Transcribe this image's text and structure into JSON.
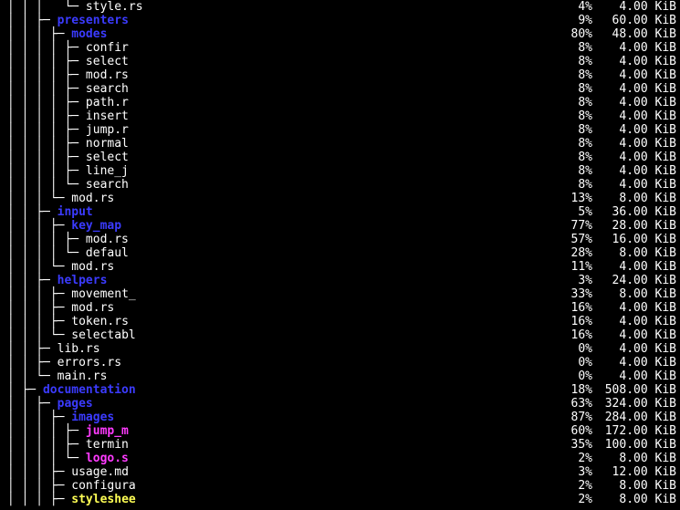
{
  "rows": [
    {
      "prefix": " │ │ │   └─ ",
      "name": "style.rs",
      "cls": "c-white",
      "pct": "4%",
      "size": "4.00 KiB"
    },
    {
      "prefix": " │ │ ├─ ",
      "name": "presenters",
      "cls": "c-blue",
      "pct": "9%",
      "size": "60.00 KiB"
    },
    {
      "prefix": " │ │ │ ├─ ",
      "name": "modes",
      "cls": "c-blue",
      "pct": "80%",
      "size": "48.00 KiB"
    },
    {
      "prefix": " │ │ │ │ ├─ ",
      "name": "confir",
      "cls": "c-white",
      "pct": "8%",
      "size": "4.00 KiB"
    },
    {
      "prefix": " │ │ │ │ ├─ ",
      "name": "select",
      "cls": "c-white",
      "pct": "8%",
      "size": "4.00 KiB"
    },
    {
      "prefix": " │ │ │ │ ├─ ",
      "name": "mod.rs",
      "cls": "c-white",
      "pct": "8%",
      "size": "4.00 KiB"
    },
    {
      "prefix": " │ │ │ │ ├─ ",
      "name": "search",
      "cls": "c-white",
      "pct": "8%",
      "size": "4.00 KiB"
    },
    {
      "prefix": " │ │ │ │ ├─ ",
      "name": "path.r",
      "cls": "c-white",
      "pct": "8%",
      "size": "4.00 KiB"
    },
    {
      "prefix": " │ │ │ │ ├─ ",
      "name": "insert",
      "cls": "c-white",
      "pct": "8%",
      "size": "4.00 KiB"
    },
    {
      "prefix": " │ │ │ │ ├─ ",
      "name": "jump.r",
      "cls": "c-white",
      "pct": "8%",
      "size": "4.00 KiB"
    },
    {
      "prefix": " │ │ │ │ ├─ ",
      "name": "normal",
      "cls": "c-white",
      "pct": "8%",
      "size": "4.00 KiB"
    },
    {
      "prefix": " │ │ │ │ ├─ ",
      "name": "select",
      "cls": "c-white",
      "pct": "8%",
      "size": "4.00 KiB"
    },
    {
      "prefix": " │ │ │ │ ├─ ",
      "name": "line_j",
      "cls": "c-white",
      "pct": "8%",
      "size": "4.00 KiB"
    },
    {
      "prefix": " │ │ │ │ └─ ",
      "name": "search",
      "cls": "c-white",
      "pct": "8%",
      "size": "4.00 KiB"
    },
    {
      "prefix": " │ │ │ └─ ",
      "name": "mod.rs",
      "cls": "c-white",
      "pct": "13%",
      "size": "8.00 KiB"
    },
    {
      "prefix": " │ │ ├─ ",
      "name": "input",
      "cls": "c-blue",
      "pct": "5%",
      "size": "36.00 KiB"
    },
    {
      "prefix": " │ │ │ ├─ ",
      "name": "key_map",
      "cls": "c-blue",
      "pct": "77%",
      "size": "28.00 KiB"
    },
    {
      "prefix": " │ │ │ │ ├─ ",
      "name": "mod.rs",
      "cls": "c-white",
      "pct": "57%",
      "size": "16.00 KiB"
    },
    {
      "prefix": " │ │ │ │ └─ ",
      "name": "defaul",
      "cls": "c-white",
      "pct": "28%",
      "size": "8.00 KiB"
    },
    {
      "prefix": " │ │ │ └─ ",
      "name": "mod.rs",
      "cls": "c-white",
      "pct": "11%",
      "size": "4.00 KiB"
    },
    {
      "prefix": " │ │ ├─ ",
      "name": "helpers",
      "cls": "c-blue",
      "pct": "3%",
      "size": "24.00 KiB"
    },
    {
      "prefix": " │ │ │ ├─ ",
      "name": "movement_",
      "cls": "c-white",
      "pct": "33%",
      "size": "8.00 KiB"
    },
    {
      "prefix": " │ │ │ ├─ ",
      "name": "mod.rs",
      "cls": "c-white",
      "pct": "16%",
      "size": "4.00 KiB"
    },
    {
      "prefix": " │ │ │ ├─ ",
      "name": "token.rs",
      "cls": "c-white",
      "pct": "16%",
      "size": "4.00 KiB"
    },
    {
      "prefix": " │ │ │ └─ ",
      "name": "selectabl",
      "cls": "c-white",
      "pct": "16%",
      "size": "4.00 KiB"
    },
    {
      "prefix": " │ │ ├─ ",
      "name": "lib.rs",
      "cls": "c-white",
      "pct": "0%",
      "size": "4.00 KiB"
    },
    {
      "prefix": " │ │ ├─ ",
      "name": "errors.rs",
      "cls": "c-white",
      "pct": "0%",
      "size": "4.00 KiB"
    },
    {
      "prefix": " │ │ └─ ",
      "name": "main.rs",
      "cls": "c-white",
      "pct": "0%",
      "size": "4.00 KiB"
    },
    {
      "prefix": " │ ├─ ",
      "name": "documentation",
      "cls": "c-blue",
      "pct": "18%",
      "size": "508.00 KiB"
    },
    {
      "prefix": " │ │ ├─ ",
      "name": "pages",
      "cls": "c-blue",
      "pct": "63%",
      "size": "324.00 KiB"
    },
    {
      "prefix": " │ │ │ ├─ ",
      "name": "images",
      "cls": "c-blue",
      "pct": "87%",
      "size": "284.00 KiB"
    },
    {
      "prefix": " │ │ │ │ ├─ ",
      "name": "jump_m",
      "cls": "c-mag",
      "pct": "60%",
      "size": "172.00 KiB"
    },
    {
      "prefix": " │ │ │ │ ├─ ",
      "name": "termin",
      "cls": "c-white",
      "pct": "35%",
      "size": "100.00 KiB"
    },
    {
      "prefix": " │ │ │ │ └─ ",
      "name": "logo.s",
      "cls": "c-mag",
      "pct": "2%",
      "size": "8.00 KiB"
    },
    {
      "prefix": " │ │ │ ├─ ",
      "name": "usage.md",
      "cls": "c-white",
      "pct": "3%",
      "size": "12.00 KiB"
    },
    {
      "prefix": " │ │ │ ├─ ",
      "name": "configura",
      "cls": "c-white",
      "pct": "2%",
      "size": "8.00 KiB"
    },
    {
      "prefix": " │ │ │ ├─ ",
      "name": "styleshee",
      "cls": "c-yel",
      "pct": "2%",
      "size": "8.00 KiB"
    }
  ]
}
